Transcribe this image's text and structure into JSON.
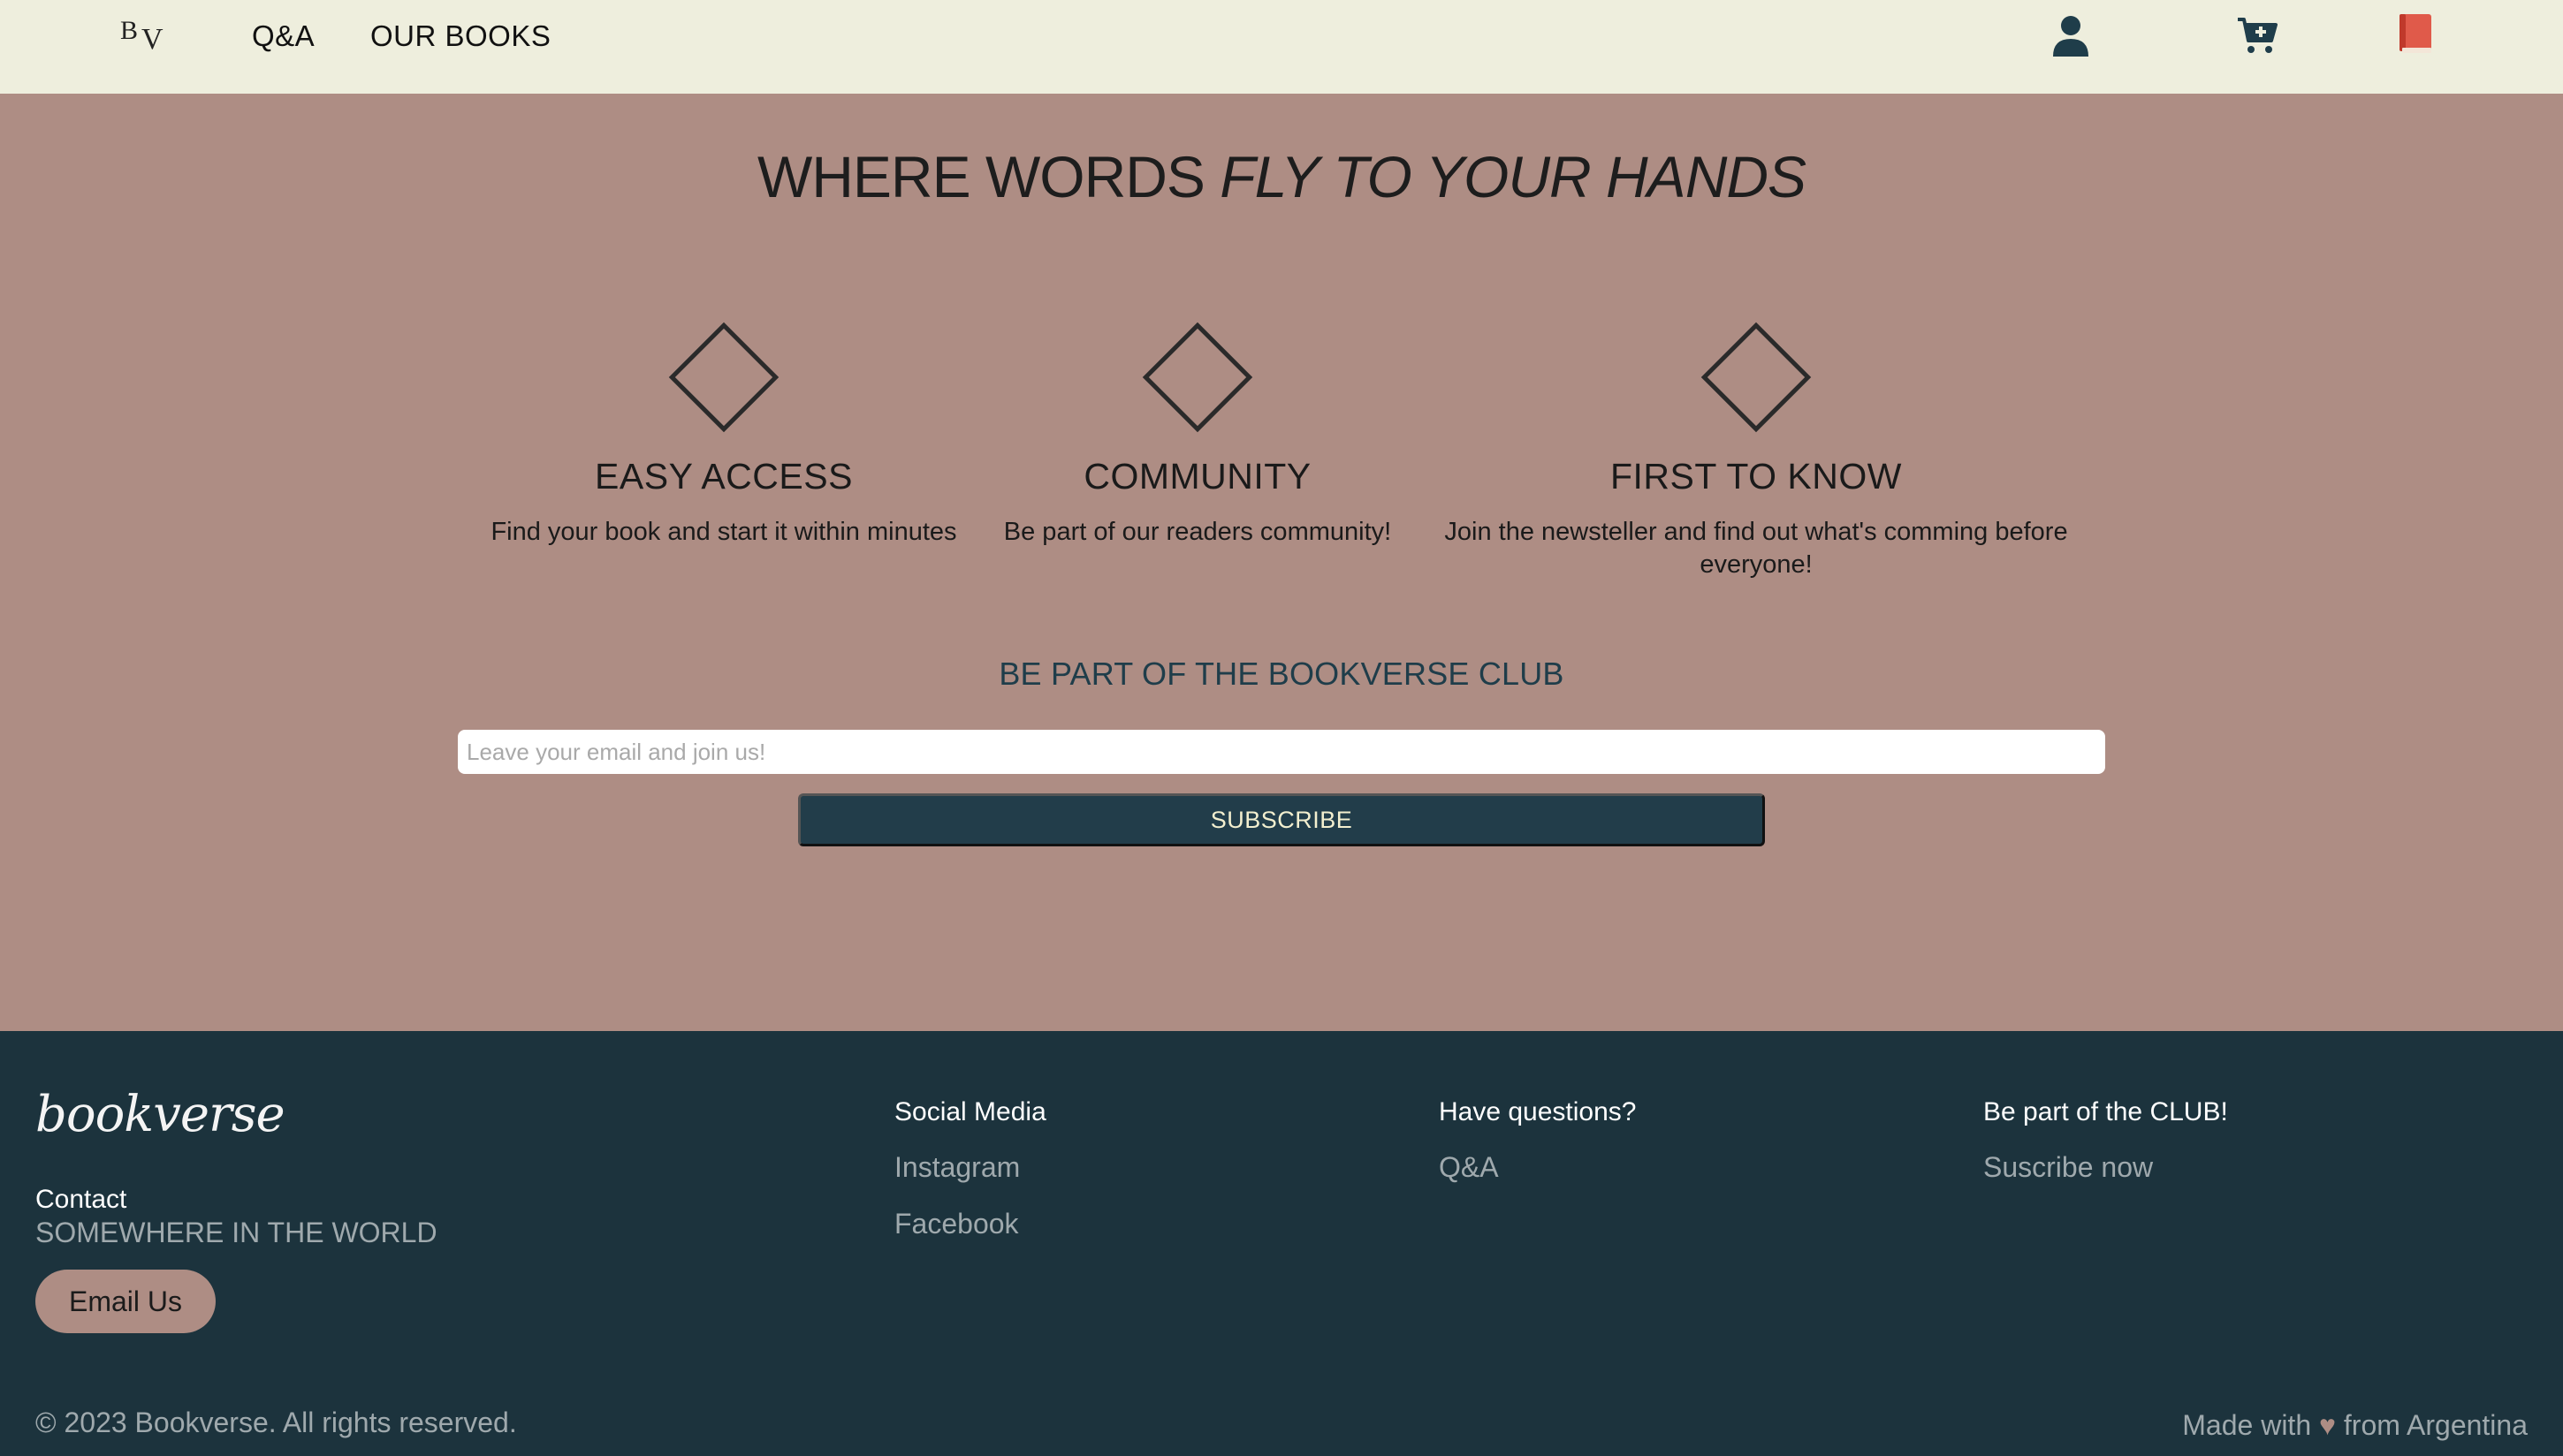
{
  "nav": {
    "logo_b": "B",
    "logo_v": "V",
    "links": [
      "Q&A",
      "OUR BOOKS"
    ],
    "icons": [
      "user-icon",
      "cart-plus-icon",
      "book-icon"
    ]
  },
  "hero": {
    "headline_plain": "WHERE WORDS ",
    "headline_italic": "FLY TO YOUR HANDS",
    "features": [
      {
        "title": "EASY ACCESS",
        "desc": "Find your book and start it within minutes"
      },
      {
        "title": "COMMUNITY",
        "desc": "Be part of our readers community!"
      },
      {
        "title": "FIRST TO KNOW",
        "desc": "Join the newsteller and find out what's comming before everyone!"
      }
    ],
    "club_title": "BE PART OF THE BOOKVERSE CLUB",
    "email_placeholder": "Leave your email and join us!",
    "subscribe_label": "SUBSCRIBE"
  },
  "footer": {
    "brand": "bookverse",
    "contact_heading": "Contact",
    "contact_location": "SOMEWHERE IN THE WORLD",
    "email_button": "Email Us",
    "social_heading": "Social Media",
    "social_links": [
      "Instagram",
      "Facebook"
    ],
    "questions_heading": "Have questions?",
    "questions_link": "Q&A",
    "club_heading": "Be part of the CLUB!",
    "club_link": "Suscribe now",
    "copyright": "© 2023 Bookverse. All rights reserved.",
    "made_with_prefix": "Made with",
    "made_with_suffix": "from Argentina"
  },
  "colors": {
    "nav_bg": "#eeeedd",
    "hero_bg": "#ae8d84",
    "footer_bg": "#1c333d",
    "accent_dark": "#223d4a",
    "button_text": "#f3efcf",
    "book_icon": "#e05a4a"
  }
}
